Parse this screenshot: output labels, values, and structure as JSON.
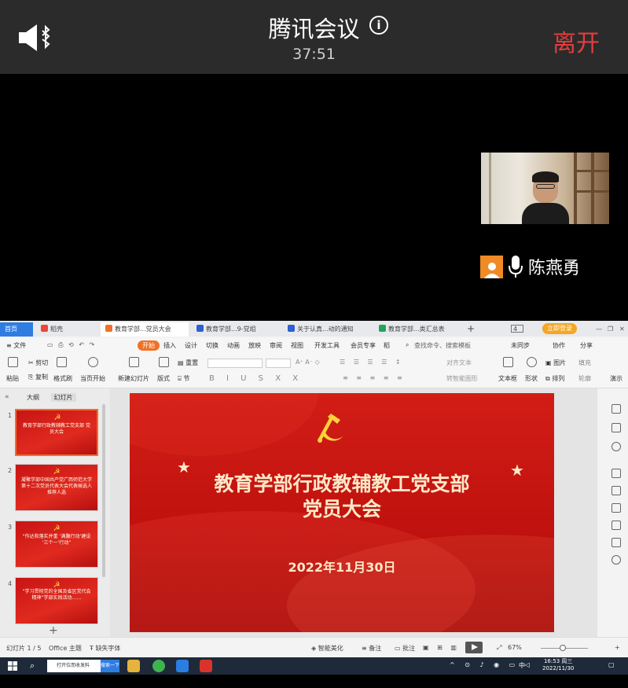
{
  "meeting": {
    "title": "腾讯会议",
    "timer": "37:51",
    "leave_label": "离开",
    "participant_name": "陈燕勇"
  },
  "wps": {
    "tabs": [
      {
        "label": "首页",
        "color": "#2f7de1"
      },
      {
        "label": "稻壳",
        "color": "#e8473a"
      },
      {
        "label": "教育学部...党员大会",
        "color": "#f07128"
      },
      {
        "label": "教育学部...9-党组",
        "color": "#2f5fd0"
      },
      {
        "label": "关于认真...动的通知",
        "color": "#2f5fd0"
      },
      {
        "label": "教育学部...类汇总表",
        "color": "#22a55b"
      }
    ],
    "new_tab": "+",
    "tab_counter": "4",
    "login_label": "立即登录",
    "menu": [
      "≡ 文件",
      "开始",
      "插入",
      "设计",
      "切换",
      "动画",
      "放映",
      "审阅",
      "视图",
      "开发工具",
      "会员专享",
      "稻"
    ],
    "search_placeholder": "查找命令、搜索模板",
    "unsync": "未同步",
    "collab": "协作",
    "share": "分享",
    "ribbon": {
      "paste": "粘贴",
      "cut": "剪切",
      "copy": "复制",
      "format_painter": "格式刷",
      "from_current": "当页开始",
      "new_slide": "新建幻灯片",
      "layout": "版式",
      "section": "节",
      "reset": "重置",
      "align_text": "对齐文本",
      "convert_smartart": "转智能图形",
      "textbox": "文本框",
      "shape": "形状",
      "picture": "图片",
      "arrange": "排列",
      "fill": "填充",
      "outline": "轮廓",
      "style": "演示"
    },
    "pane_tabs": [
      "大纲",
      "幻灯片"
    ],
    "thumbnails": [
      {
        "num": "1",
        "text": "教育学部行政教辅教工党支部 党员大会"
      },
      {
        "num": "2",
        "text": "凝聚学部中国共产党广西师范大学第十二次党员代表大会代表候选人推荐人选"
      },
      {
        "num": "3",
        "text": "“作达和落实并重 ‘满腹行动’建设 ‘三个一’行动”"
      },
      {
        "num": "4",
        "text": "“学习贯彻党的全国及省区党代会精神”学部实践活动……"
      }
    ],
    "add_slide": "+",
    "slide": {
      "title_line1": "教育学部行政教辅教工党支部",
      "title_line2": "党员大会",
      "date": "2022年11月30日"
    },
    "status": {
      "slide_count": "幻灯片 1 / 5",
      "theme": "Office 主题",
      "missing_fonts": "缺失字体",
      "smart_beautify": "智能美化",
      "notes": "备注",
      "comments": "批注",
      "zoom": "67%"
    }
  },
  "taskbar": {
    "search_text": "打开位而收发料",
    "search_btn": "搜索一下",
    "ime": "中",
    "time": "16:53 周三",
    "date": "2022/11/30"
  },
  "colors": {
    "leave": "#e53d3d",
    "accent_orange": "#f07128",
    "slide_red": "#c8141a",
    "slide_gold": "#fde8c8",
    "emblem": "#ffd23c"
  },
  "icons": [
    "speaker-bluetooth-icon",
    "info-icon",
    "avatar-icon",
    "mic-icon",
    "hammer-sickle-icon",
    "star-icon",
    "play-icon",
    "windows-icon",
    "search-icon"
  ]
}
